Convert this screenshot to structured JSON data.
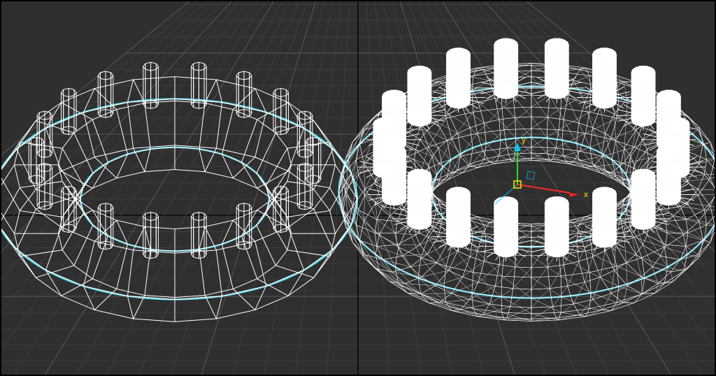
{
  "axis_labels": {
    "y": "y",
    "x": "x"
  },
  "colors": {
    "grid_major": "#585858",
    "grid_minor": "#3d3d3d",
    "grid_axis": "#000000",
    "wireframe": "#ffffff",
    "selection": "#58d8f0",
    "axis_x_line": "#ff2626",
    "axis_x_label": "#ffe600",
    "axis_y_line": "#2fd82f",
    "axis_y_cone": "#00ccff",
    "axis_z_cone": "#ff2626",
    "gizmo_box": "#ffe600"
  }
}
